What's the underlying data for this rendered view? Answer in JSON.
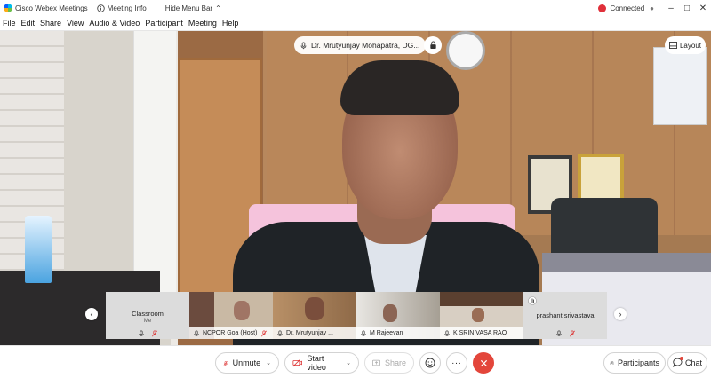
{
  "titlebar": {
    "app_name": "Cisco Webex Meetings",
    "meeting_info": "Meeting Info",
    "hide_menu_bar": "Hide Menu Bar",
    "status": "Connected",
    "status_color": "#e0303a"
  },
  "menu": [
    "File",
    "Edit",
    "Share",
    "View",
    "Audio & Video",
    "Participant",
    "Meeting",
    "Help"
  ],
  "active_speaker": {
    "name": "Dr. Mrutyunjay Mohapatra, DG..."
  },
  "layout_label": "Layout",
  "filmstrip": [
    {
      "name": "Classroom",
      "sub": "Me",
      "style": "light"
    },
    {
      "name": "NCPOR Goa (Host)",
      "style": "video"
    },
    {
      "name": "Dr. Mrutyunjay ...",
      "style": "video"
    },
    {
      "name": "M Rajeevan",
      "style": "video"
    },
    {
      "name": "K SRINIVASA RAO",
      "style": "video"
    },
    {
      "name": "prashant srivastava",
      "style": "light"
    }
  ],
  "toolbar": {
    "unmute": "Unmute",
    "start_video": "Start video",
    "share": "Share",
    "participants": "Participants",
    "chat": "Chat",
    "end_color": "#e3463b"
  }
}
